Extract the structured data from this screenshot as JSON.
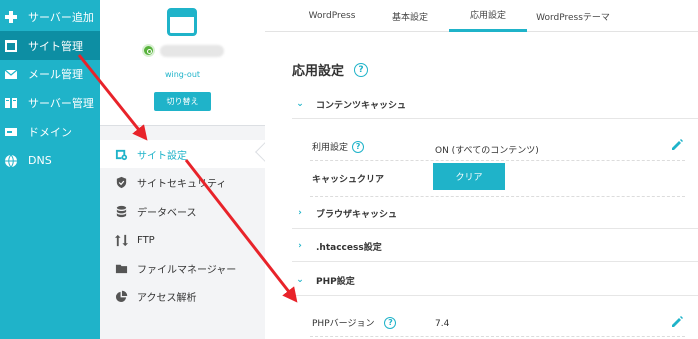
{
  "leftnav": {
    "items": [
      {
        "label": "サーバー追加",
        "icon": "plus-icon"
      },
      {
        "label": "サイト管理",
        "icon": "window-icon"
      },
      {
        "label": "メール管理",
        "icon": "mail-icon"
      },
      {
        "label": "サーバー管理",
        "icon": "server-icon"
      },
      {
        "label": "ドメイン",
        "icon": "domain-icon"
      },
      {
        "label": "DNS",
        "icon": "globe-icon"
      }
    ]
  },
  "server": {
    "name": "wing-out",
    "switch_label": "切り替え",
    "status_color": "#58b23c"
  },
  "subnav": {
    "items": [
      {
        "label": "サイト設定",
        "icon": "site-settings-icon"
      },
      {
        "label": "サイトセキュリティ",
        "icon": "shield-icon"
      },
      {
        "label": "データベース",
        "icon": "database-icon"
      },
      {
        "label": "FTP",
        "icon": "ftp-icon"
      },
      {
        "label": "ファイルマネージャー",
        "icon": "folder-icon"
      },
      {
        "label": "アクセス解析",
        "icon": "pie-chart-icon"
      }
    ]
  },
  "tabs": [
    {
      "label": "WordPress"
    },
    {
      "label": "基本設定"
    },
    {
      "label": "応用設定"
    },
    {
      "label": "WordPressテーマ"
    }
  ],
  "page": {
    "title": "応用設定",
    "help": "?"
  },
  "sections": {
    "content_cache": {
      "title": "コンテンツキャッシュ",
      "usage_label": "利用設定",
      "usage_value": "ON (すべてのコンテンツ)",
      "clear_label": "キャッシュクリア",
      "clear_button": "クリア"
    },
    "browser_cache": {
      "title": "ブラウザキャッシュ"
    },
    "htaccess": {
      "title": ".htaccess設定"
    },
    "php": {
      "title": "PHP設定",
      "version_label": "PHPバージョン",
      "version_value": "7.4"
    }
  },
  "colors": {
    "accent": "#1fb3c9",
    "nav_active": "#0d8ea3",
    "annotation": "#e8232a"
  }
}
